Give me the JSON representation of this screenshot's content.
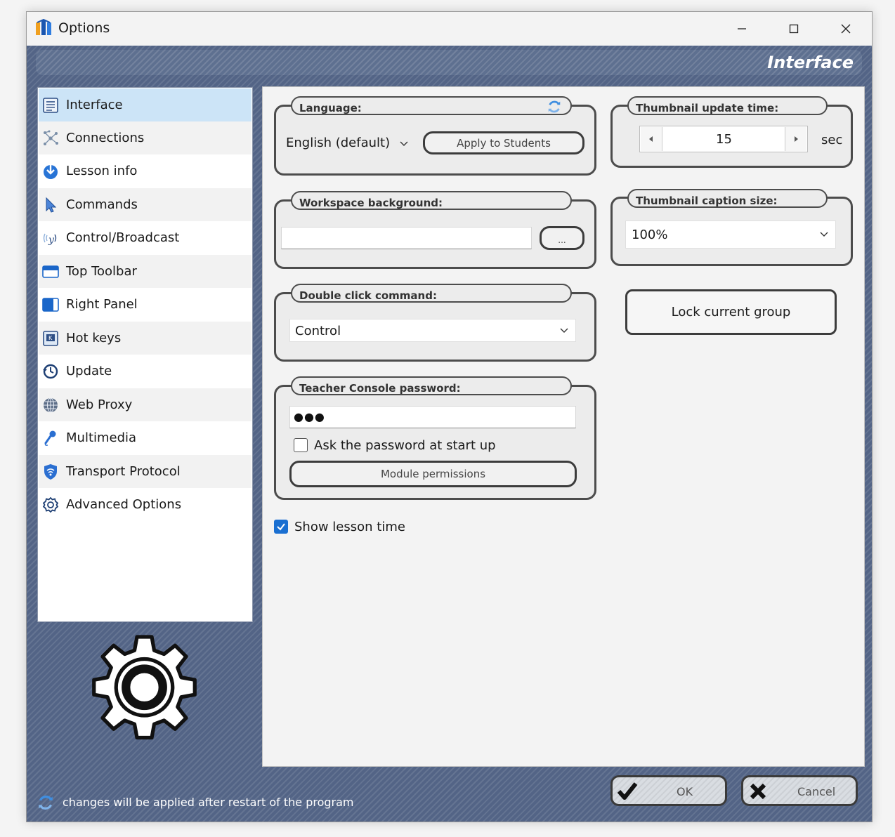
{
  "window": {
    "title": "Options",
    "minimize_glyph": "—",
    "maximize_glyph": "☐",
    "close_glyph": "✕"
  },
  "header": {
    "section_title": "Interface"
  },
  "sidebar": {
    "items": [
      {
        "label": "Interface",
        "icon": "interface-icon"
      },
      {
        "label": "Connections",
        "icon": "network-icon"
      },
      {
        "label": "Lesson info",
        "icon": "download-icon"
      },
      {
        "label": "Commands",
        "icon": "pointer-icon"
      },
      {
        "label": "Control/Broadcast",
        "icon": "broadcast-icon"
      },
      {
        "label": "Top Toolbar",
        "icon": "toolbar-icon"
      },
      {
        "label": "Right Panel",
        "icon": "panel-icon"
      },
      {
        "label": "Hot keys",
        "icon": "keyboard-icon"
      },
      {
        "label": "Update",
        "icon": "history-icon"
      },
      {
        "label": "Web Proxy",
        "icon": "globe-icon"
      },
      {
        "label": "Multimedia",
        "icon": "microphone-icon"
      },
      {
        "label": "Transport Protocol",
        "icon": "shield-icon"
      },
      {
        "label": "Advanced Options",
        "icon": "settings-icon"
      }
    ]
  },
  "language": {
    "label": "Language:",
    "value": "English (default)",
    "apply_button": "Apply to Students"
  },
  "workspace": {
    "label": "Workspace background:",
    "value": "",
    "browse_button": "..."
  },
  "double_click": {
    "label": "Double click command:",
    "value": "Control"
  },
  "password": {
    "label": "Teacher Console password:",
    "value": "●●●",
    "ask_checkbox_label": "Ask the password at start up",
    "ask_checked": false,
    "module_permissions_button": "Module permissions"
  },
  "show_lesson_time": {
    "label": "Show lesson time",
    "checked": true
  },
  "thumbnail_update": {
    "label": "Thumbnail update time:",
    "value": "15",
    "unit": "sec"
  },
  "thumbnail_caption": {
    "label": "Thumbnail caption size:",
    "value": "100%"
  },
  "lock_group_button": "Lock current group",
  "footer": {
    "note": "changes will be applied after restart of the program",
    "ok": "OK",
    "cancel": "Cancel"
  },
  "colors": {
    "accent": "#1a6fd1",
    "selected_bg": "#cce4f7",
    "frame": "#536486"
  }
}
